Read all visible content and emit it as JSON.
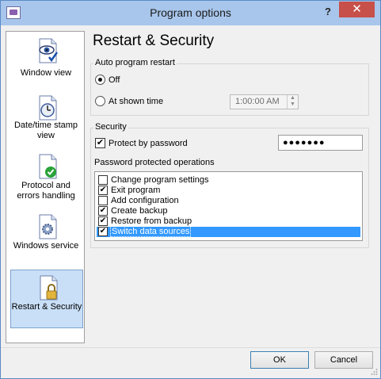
{
  "window": {
    "title": "Program options"
  },
  "titlebar": {
    "help": "?",
    "close": "✕"
  },
  "sidebar": {
    "items": [
      {
        "label": "Window view",
        "icon": "window-view-icon"
      },
      {
        "label": "Date/time stamp view",
        "icon": "clock-icon"
      },
      {
        "label": "Protocol and errors handling",
        "icon": "check-document-icon"
      },
      {
        "label": "Windows service",
        "icon": "gear-document-icon"
      },
      {
        "label": "Restart & Security",
        "icon": "lock-document-icon",
        "selected": true
      }
    ]
  },
  "page": {
    "title": "Restart & Security"
  },
  "restart": {
    "group_label": "Auto program restart",
    "off_label": "Off",
    "shown_time_label": "At shown time",
    "time_value": "1:00:00 AM",
    "selected": "off"
  },
  "security": {
    "group_label": "Security",
    "protect_label": "Protect by password",
    "protect_checked": true,
    "password_value": "●●●●●●●",
    "ops_label": "Password protected operations",
    "operations": [
      {
        "label": "Change program settings",
        "checked": false
      },
      {
        "label": "Exit program",
        "checked": true
      },
      {
        "label": "Add configuration",
        "checked": false
      },
      {
        "label": "Create backup",
        "checked": true
      },
      {
        "label": "Restore from backup",
        "checked": true
      },
      {
        "label": "Switch data sources",
        "checked": true,
        "selected": true
      }
    ]
  },
  "footer": {
    "ok_label": "OK",
    "cancel_label": "Cancel"
  }
}
